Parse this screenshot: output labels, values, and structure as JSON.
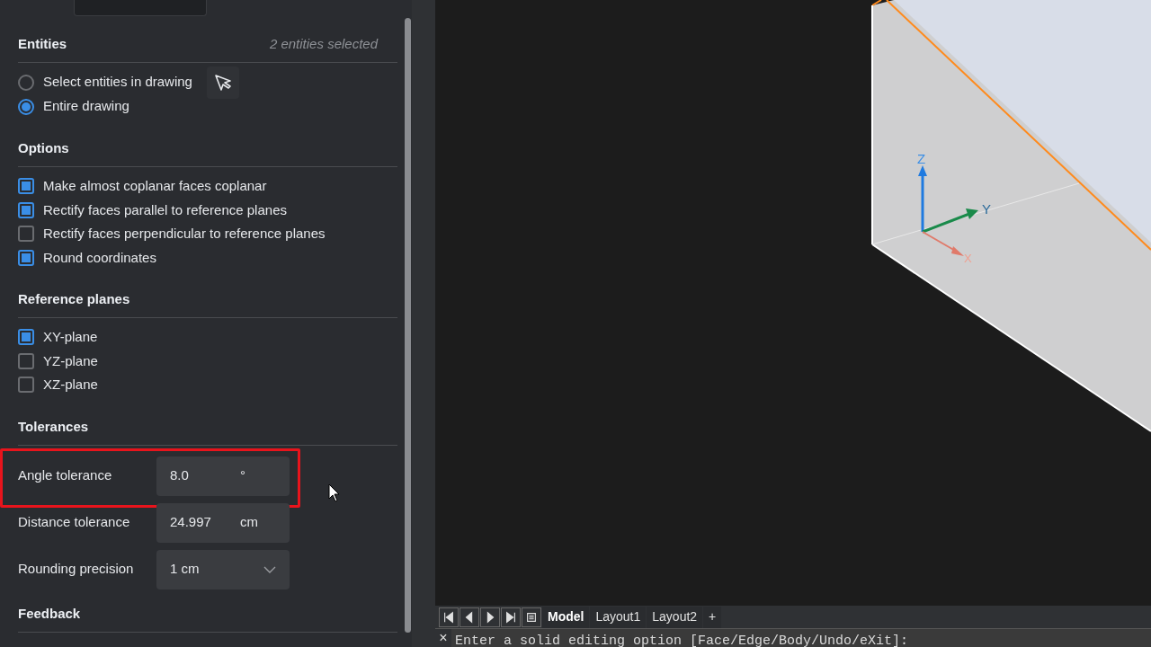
{
  "entities": {
    "title": "Entities",
    "count": "2 entities selected",
    "options": [
      {
        "label": "Select entities in drawing",
        "selected": false,
        "pick_button": true
      },
      {
        "label": "Entire drawing",
        "selected": true,
        "pick_button": false
      }
    ]
  },
  "options": {
    "title": "Options",
    "items": [
      {
        "label": "Make almost coplanar faces coplanar",
        "checked": true
      },
      {
        "label": "Rectify faces parallel to reference planes",
        "checked": true
      },
      {
        "label": "Rectify faces perpendicular to reference planes",
        "checked": false
      },
      {
        "label": "Round coordinates",
        "checked": true
      }
    ]
  },
  "reference_planes": {
    "title": "Reference planes",
    "items": [
      {
        "label": "XY-plane",
        "checked": true
      },
      {
        "label": "YZ-plane",
        "checked": false
      },
      {
        "label": "XZ-plane",
        "checked": false
      }
    ]
  },
  "tolerances": {
    "title": "Tolerances",
    "fields": [
      {
        "kind": "number",
        "label": "Angle tolerance",
        "value": "8.0",
        "unit": "°",
        "highlighted": true
      },
      {
        "kind": "number",
        "label": "Distance tolerance",
        "value": "24.997",
        "unit": "cm",
        "highlighted": false
      },
      {
        "kind": "dropdown",
        "label": "Rounding precision",
        "value": "1 cm",
        "highlighted": false
      }
    ]
  },
  "feedback": {
    "title": "Feedback"
  },
  "viewport": {
    "axes": {
      "x": "X",
      "y": "Y",
      "z": "Z"
    }
  },
  "layout_tabs": [
    {
      "label": "Model",
      "selected": true
    },
    {
      "label": "Layout1",
      "selected": false
    },
    {
      "label": "Layout2",
      "selected": false
    },
    {
      "label": "+",
      "selected": false
    }
  ],
  "command_line": {
    "close": "×",
    "text": "Enter a solid editing option [Face/Edge/Body/Undo/eXit]:"
  }
}
